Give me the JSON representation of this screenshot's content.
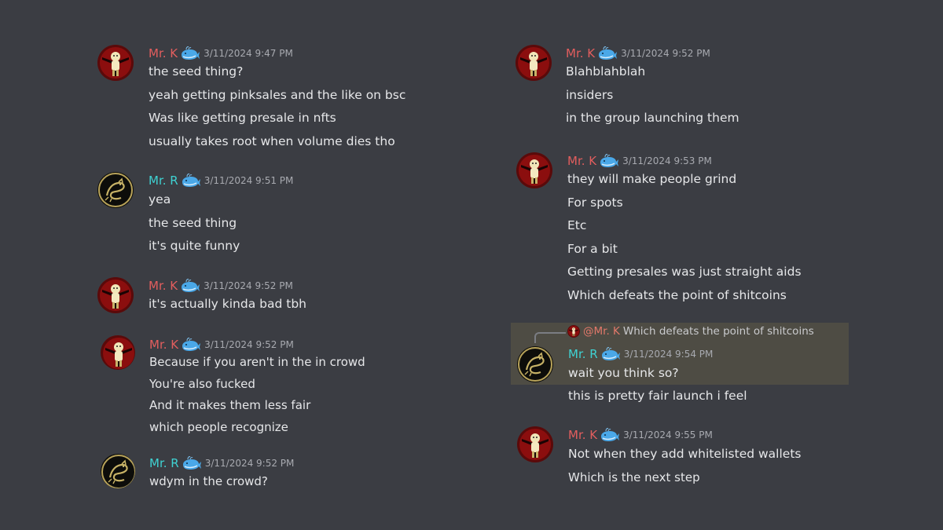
{
  "colors": {
    "background": "#3b3d43",
    "mr_k": "#e25e5e",
    "mr_r": "#3fd2d2",
    "timestamp": "#a8aab0",
    "highlight": "#4e4c44"
  },
  "icons": {
    "badge": "whale-icon",
    "avatar_k": "figure-avatar",
    "avatar_r": "dragon-avatar"
  },
  "left": [
    {
      "user": "Mr. K",
      "timestamp": "3/11/2024 9:47 PM",
      "lines": [
        "the seed thing?",
        "yeah getting pinksales and the like on bsc",
        "Was like getting presale in nfts",
        "usually takes root when volume dies tho"
      ]
    },
    {
      "user": "Mr. R",
      "timestamp": "3/11/2024 9:51 PM",
      "lines": [
        "yea",
        "the seed thing",
        "it's quite funny"
      ]
    },
    {
      "user": "Mr. K",
      "timestamp": "3/11/2024 9:52 PM",
      "lines": [
        "it's actually kinda bad tbh"
      ]
    },
    {
      "user": "Mr. K",
      "timestamp": "3/11/2024 9:52 PM",
      "lines": [
        "Because if you aren't in the in crowd",
        "You're also fucked",
        "And it makes them less fair",
        "which people recognize"
      ]
    },
    {
      "user": "Mr. R",
      "timestamp": "3/11/2024 9:52 PM",
      "lines": [
        "wdym in the crowd?"
      ]
    }
  ],
  "right": [
    {
      "user": "Mr. K",
      "timestamp": "3/11/2024 9:52 PM",
      "lines": [
        "Blahblahblah",
        "insiders",
        "in the group launching them"
      ]
    },
    {
      "user": "Mr. K",
      "timestamp": "3/11/2024 9:53 PM",
      "lines": [
        "they will make people grind",
        "For spots",
        "Etc",
        "For a bit",
        "Getting presales was just straight aids",
        "Which defeats the point of shitcoins"
      ]
    },
    {
      "user": "Mr. R",
      "timestamp": "3/11/2024 9:54 PM",
      "reply": {
        "mention": "@Mr. K",
        "text": "Which defeats the point of shitcoins"
      },
      "lines": [
        "wait you think so?",
        "this is pretty fair launch i feel"
      ]
    },
    {
      "user": "Mr. K",
      "timestamp": "3/11/2024 9:55 PM",
      "lines": [
        "Not when they add whitelisted wallets",
        "Which is the next step"
      ]
    }
  ]
}
